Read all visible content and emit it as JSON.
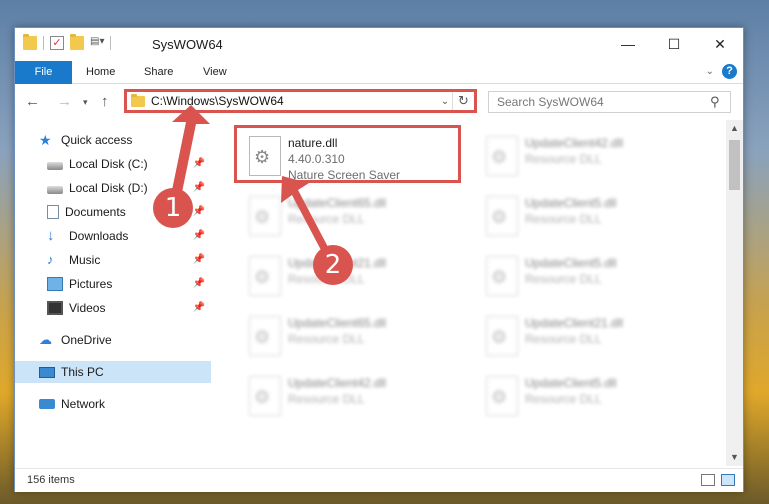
{
  "window": {
    "title": "SysWOW64",
    "controls": {
      "minimize": "—",
      "maximize": "☐",
      "close": "✕"
    }
  },
  "ribbon": {
    "tabs": [
      "File",
      "Home",
      "Share",
      "View"
    ]
  },
  "address": {
    "path": "C:\\Windows\\SysWOW64",
    "search_placeholder": "Search SysWOW64"
  },
  "sidebar": {
    "items": [
      {
        "label": "Quick access",
        "icon": "star-icon"
      },
      {
        "label": "Local Disk (C:)",
        "icon": "disk-icon",
        "pinned": true
      },
      {
        "label": "Local Disk (D:)",
        "icon": "disk-icon",
        "pinned": true
      },
      {
        "label": "Documents",
        "icon": "documents-icon",
        "pinned": true
      },
      {
        "label": "Downloads",
        "icon": "downloads-icon",
        "pinned": true
      },
      {
        "label": "Music",
        "icon": "music-icon",
        "pinned": true
      },
      {
        "label": "Pictures",
        "icon": "pictures-icon",
        "pinned": true
      },
      {
        "label": "Videos",
        "icon": "videos-icon",
        "pinned": true
      },
      {
        "label": "OneDrive",
        "icon": "cloud-icon"
      },
      {
        "label": "This PC",
        "icon": "computer-icon",
        "selected": true
      },
      {
        "label": "Network",
        "icon": "network-icon"
      }
    ]
  },
  "files": [
    {
      "name": "nature.dll",
      "version": "4.40.0.310",
      "description": "Nature Screen Saver",
      "highlighted": true
    },
    {
      "name": "UpdateClient42.dll",
      "description": "Resource DLL"
    },
    {
      "name": "UpdateClient65.dll",
      "description": "Resource DLL"
    },
    {
      "name": "UpdateClient5.dll",
      "description": "Resource DLL"
    },
    {
      "name": "UpdateClient21.dll",
      "description": "Resource DLL"
    },
    {
      "name": "UpdateClient5.dll",
      "description": "Resource DLL"
    },
    {
      "name": "UpdateClient65.dll",
      "description": "Resource DLL"
    },
    {
      "name": "UpdateClient21.dll",
      "description": "Resource DLL"
    },
    {
      "name": "UpdateClient42.dll",
      "description": "Resource DLL"
    },
    {
      "name": "UpdateClient5.dll",
      "description": "Resource DLL"
    }
  ],
  "status": {
    "item_count": "156 items"
  },
  "callouts": [
    "1",
    "2"
  ],
  "colors": {
    "accent": "#1979ca",
    "highlight": "#d9534f",
    "selection": "#cce4f7"
  }
}
